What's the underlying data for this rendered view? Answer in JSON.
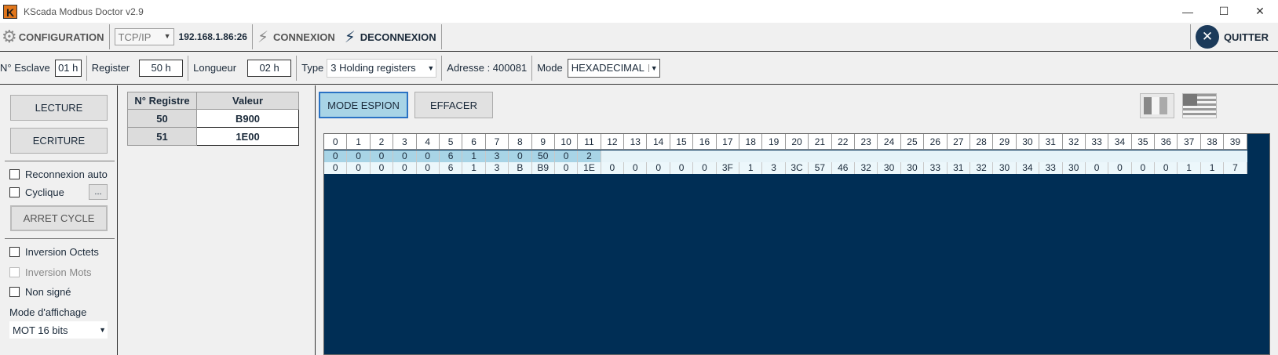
{
  "window": {
    "title": "KScada Modbus Doctor v2.9",
    "logo_letter": "K"
  },
  "toolbar": {
    "configuration": "CONFIGURATION",
    "protocol": "TCP/IP",
    "ip": "192.168.1.86:26",
    "connexion": "CONNEXION",
    "deconnexion": "DECONNEXION",
    "quitter": "QUITTER"
  },
  "params": {
    "esclave_label": "N° Esclave",
    "esclave_value": "01 h",
    "register_label": "Register",
    "register_value": "50 h",
    "longueur_label": "Longueur",
    "longueur_value": "02 h",
    "type_label": "Type",
    "type_value": "3 Holding registers",
    "adresse": "Adresse : 400081",
    "mode_label": "Mode",
    "mode_value": "HEXADECIMAL"
  },
  "left": {
    "lecture": "LECTURE",
    "ecriture": "ECRITURE",
    "reconnexion_auto": "Reconnexion auto",
    "cyclique": "Cyclique",
    "cyclique_more": "...",
    "arret_cycle": "ARRET CYCLE",
    "inversion_octets": "Inversion Octets",
    "inversion_mots": "Inversion Mots",
    "non_signe": "Non signé",
    "mode_affichage_label": "Mode d'affichage",
    "mode_affichage_value": "MOT 16 bits"
  },
  "registers": {
    "headers": [
      "N° Registre",
      "Valeur"
    ],
    "rows": [
      {
        "addr": "50",
        "value": "B900"
      },
      {
        "addr": "51",
        "value": "1E00"
      }
    ]
  },
  "spy": {
    "mode_espion": "MODE ESPION",
    "effacer": "EFFACER",
    "columns": [
      "0",
      "1",
      "2",
      "3",
      "4",
      "5",
      "6",
      "7",
      "8",
      "9",
      "10",
      "11",
      "12",
      "13",
      "14",
      "15",
      "16",
      "17",
      "18",
      "19",
      "20",
      "21",
      "22",
      "23",
      "24",
      "25",
      "26",
      "27",
      "28",
      "29",
      "30",
      "31",
      "32",
      "33",
      "34",
      "35",
      "36",
      "37",
      "38",
      "39"
    ],
    "row_request": [
      "0",
      "0",
      "0",
      "0",
      "0",
      "6",
      "1",
      "3",
      "0",
      "50",
      "0",
      "2"
    ],
    "row_response": [
      "0",
      "0",
      "0",
      "0",
      "0",
      "6",
      "1",
      "3",
      "B",
      "B9",
      "0",
      "1E",
      "0",
      "0",
      "0",
      "0",
      "0",
      "3F",
      "1",
      "3",
      "3C",
      "57",
      "46",
      "32",
      "30",
      "30",
      "33",
      "31",
      "32",
      "30",
      "34",
      "33",
      "30",
      "0",
      "0",
      "0",
      "0",
      "1",
      "1",
      "7"
    ]
  },
  "colors": {
    "grid_bg": "#002e55",
    "mode_espion_active": "#a8d4e6",
    "accent": "#1b3a5a"
  }
}
